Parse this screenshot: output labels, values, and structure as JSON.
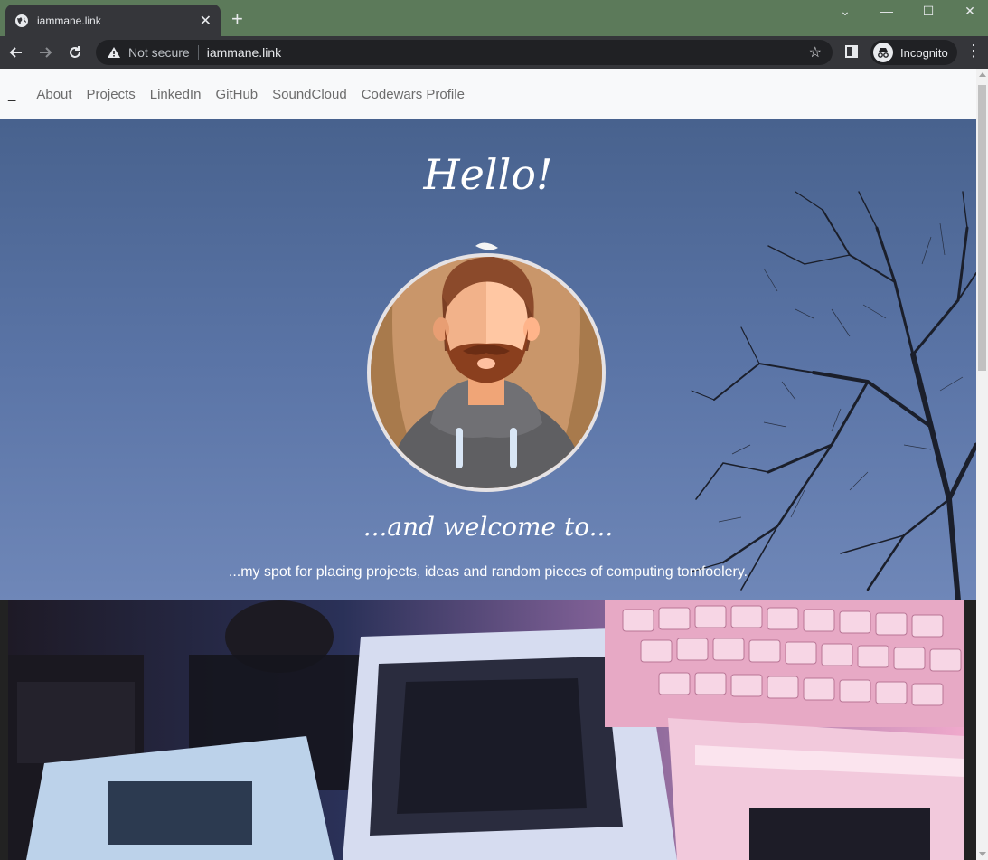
{
  "browser": {
    "tab_title": "iammane.link",
    "tab_close": "✕",
    "new_tab": "+",
    "not_secure": "Not secure",
    "url": "iammane.link",
    "incognito_label": "Incognito",
    "minimize": "—",
    "maximize": "☐",
    "close": "✕",
    "tab_search": "⌄",
    "icons": [
      "globe-icon",
      "back-icon",
      "forward-icon",
      "reload-icon",
      "warning-icon",
      "star-icon",
      "side-panel-icon",
      "incognito-icon",
      "menu-icon"
    ]
  },
  "site": {
    "brand": "_",
    "nav": [
      "About",
      "Projects",
      "LinkedIn",
      "GitHub",
      "SoundCloud",
      "Codewars Profile"
    ],
    "hero": {
      "heading": "Hello!",
      "subheading": "...and welcome to...",
      "tagline": "...my spot for placing projects, ideas and random pieces of computing tomfoolery."
    }
  },
  "colors": {
    "chrome_frame": "#5c7a5a",
    "toolbar": "#35363a",
    "hero_top": "#48628e",
    "hero_bottom": "#6f87b8"
  }
}
